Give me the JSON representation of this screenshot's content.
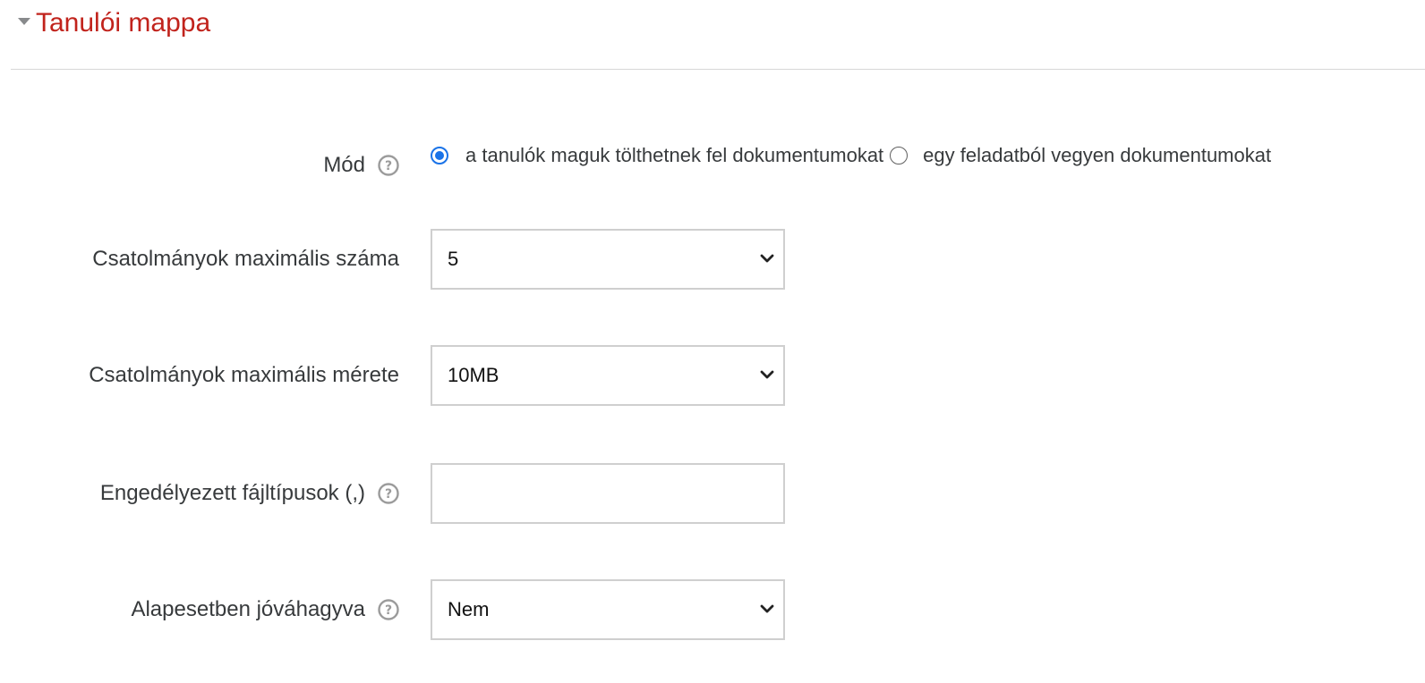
{
  "section": {
    "title": "Tanulói mappa"
  },
  "mode": {
    "label": "Mód",
    "options": [
      {
        "label": "a tanulók maguk tölthetnek fel dokumentumokat",
        "selected": true
      },
      {
        "label": "egy feladatból vegyen dokumentumokat",
        "selected": false
      }
    ]
  },
  "max_attachments": {
    "label": "Csatolmányok maximális száma",
    "value": "5"
  },
  "max_size": {
    "label": "Csatolmányok maximális mérete",
    "value": "10MB"
  },
  "file_types": {
    "label": "Engedélyezett fájltípusok (,)",
    "value": ""
  },
  "approved_default": {
    "label": "Alapesetben jóváhagyva",
    "value": "Nem"
  },
  "colors": {
    "title": "#c1231c",
    "radio_accent": "#1a73e8",
    "help_icon": "#9b9b9b",
    "border": "#cfcfcf"
  },
  "icons": {
    "collapse": "caret-down-icon",
    "help": "question-circle-icon",
    "select": "chevron-down-icon"
  }
}
